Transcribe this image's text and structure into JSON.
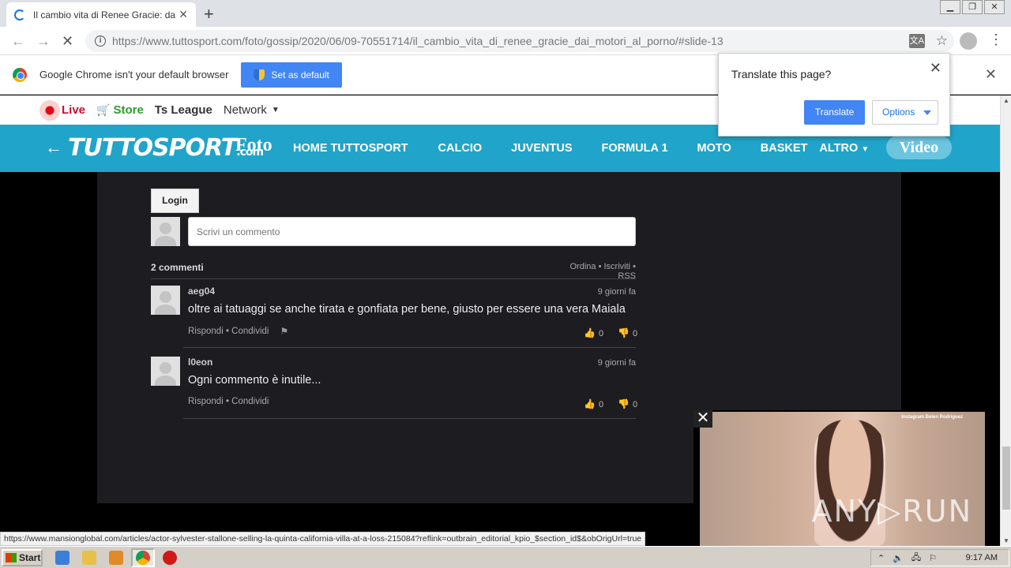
{
  "browser": {
    "tab_title": "Il cambio vita di Renee Gracie: dai m",
    "tab_close": "✕",
    "new_tab": "+",
    "url_domain": "https://www.tuttosport.com",
    "url_path": "/foto/gossip/2020/06/09-70551714/il_cambio_vita_di_renee_gracie_dai_motori_al_porno/#slide-13",
    "info_icon": "i"
  },
  "infobar": {
    "message": "Google Chrome isn't your default browser",
    "button": "Set as default",
    "close": "✕"
  },
  "translate_popup": {
    "title": "Translate this page?",
    "translate_button": "Translate",
    "options_button": "Options",
    "close": "✕"
  },
  "top_strip": {
    "live": "Live",
    "store": "Store",
    "league": "Ts League",
    "network": "Network"
  },
  "navbar": {
    "logo": "TUTTOSPORT",
    "logo_suffix": ".com",
    "section": "Foto",
    "links": [
      "HOME TUTTOSPORT",
      "CALCIO",
      "JUVENTUS",
      "FORMULA 1",
      "MOTO",
      "BASKET",
      "ALTRO"
    ],
    "video": "Video"
  },
  "comments": {
    "login": "Login",
    "input_placeholder": "Scrivi un commento",
    "count": "2 commenti",
    "sort_links": "Ordina • Iscriviti • RSS",
    "items": [
      {
        "author": "aeg04",
        "date": "9 giorni fa",
        "text": "oltre ai tatuaggi se anche tirata e gonfiata per bene, giusto per essere una vera Maiala",
        "actions": "Rispondi • Condividi",
        "up": "0",
        "down": "0"
      },
      {
        "author": "l0eon",
        "date": "9 giorni fa",
        "text": "Ogni commento è inutile...",
        "actions": "Rispondi • Condividi",
        "up": "0",
        "down": "0"
      }
    ]
  },
  "video_ad": {
    "caption": "Instagram Belen Rodriguez",
    "watermark": "ANY▷RUN"
  },
  "status_url": "https://www.mansionglobal.com/articles/actor-sylvester-stallone-selling-la-quinta-california-villa-at-a-loss-215084?reflink=outbrain_editorial_kpio_$section_id$&obOrigUrl=true",
  "taskbar": {
    "start": "Start",
    "clock": "9:17 AM"
  }
}
